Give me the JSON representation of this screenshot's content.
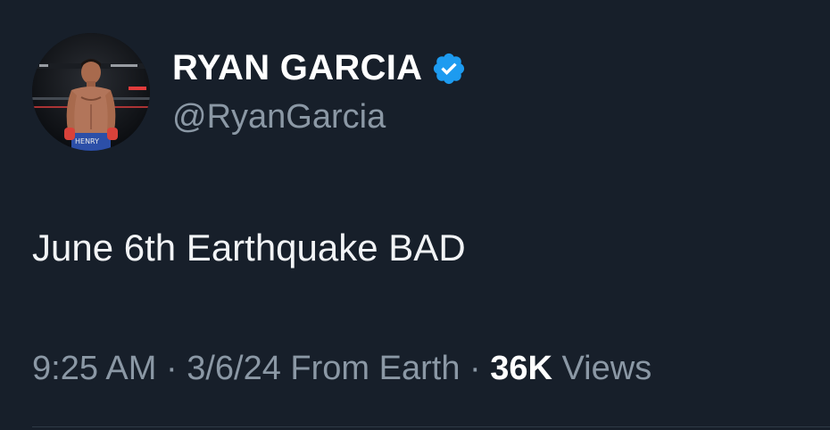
{
  "author": {
    "name": "RYAN GARCIA",
    "handle": "@RyanGarcia",
    "verified": true,
    "avatar_icon": "boxer-portrait",
    "avatar_trunks_text": "HENRY"
  },
  "tweet": {
    "text": "June 6th Earthquake BAD"
  },
  "meta": {
    "time": "9:25 AM",
    "sep1": " · ",
    "date": "3/6/24",
    "source": " From Earth",
    "sep2": " · ",
    "views_count": "36K",
    "views_label": " Views"
  },
  "colors": {
    "background": "#171f2a",
    "verified_badge": "#1d9bf0",
    "secondary_text": "#8b98a5",
    "primary_text": "#ffffff"
  }
}
